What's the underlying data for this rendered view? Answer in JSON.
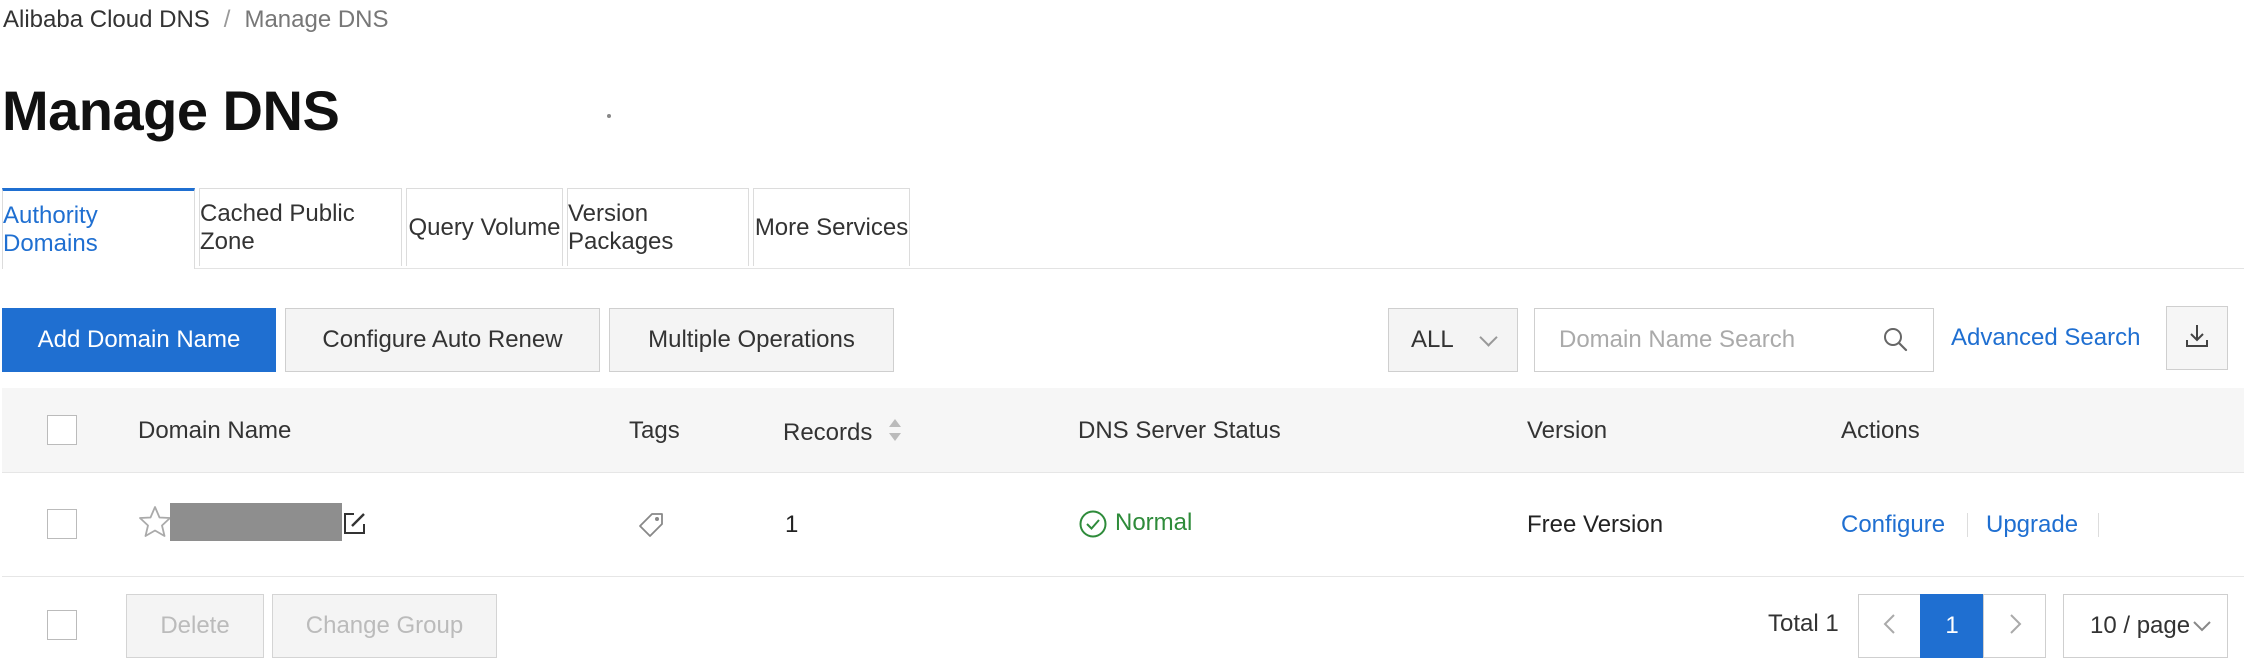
{
  "breadcrumb": {
    "root": "Alibaba Cloud DNS",
    "separator": "/",
    "current": "Manage DNS"
  },
  "page_title": "Manage DNS",
  "tabs": [
    {
      "label": "Authority Domains",
      "active": true
    },
    {
      "label": "Cached Public Zone",
      "active": false
    },
    {
      "label": "Query Volume",
      "active": false
    },
    {
      "label": "Version Packages",
      "active": false
    },
    {
      "label": "More Services",
      "active": false
    }
  ],
  "toolbar": {
    "add_domain": "Add Domain Name",
    "auto_renew": "Configure Auto Renew",
    "multiple_ops": "Multiple Operations",
    "filter_value": "ALL",
    "search_placeholder": "Domain Name Search",
    "advanced_search": "Advanced Search"
  },
  "table": {
    "columns": {
      "domain": "Domain Name",
      "tags": "Tags",
      "records": "Records",
      "status": "DNS Server Status",
      "version": "Version",
      "actions": "Actions"
    },
    "rows": [
      {
        "domain": "",
        "records": "1",
        "status": "Normal",
        "version": "Free Version",
        "actions": [
          "Configure",
          "Upgrade"
        ]
      }
    ]
  },
  "footer": {
    "delete": "Delete",
    "change_group": "Change Group",
    "total_label": "Total 1",
    "current_page": "1",
    "page_size": "10 / page"
  },
  "colors": {
    "accent": "#1f6fd1",
    "status_ok": "#2e8b3a"
  }
}
